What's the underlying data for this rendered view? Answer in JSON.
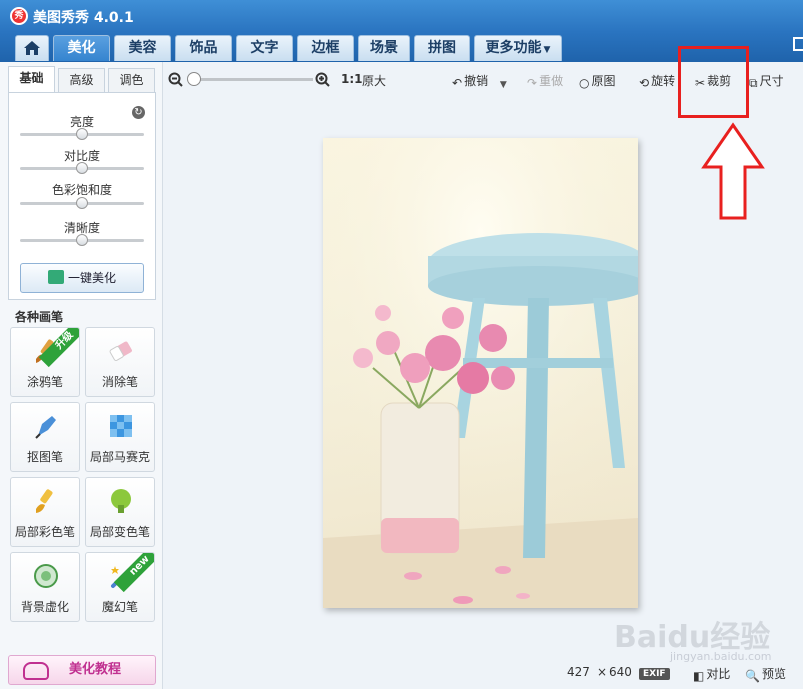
{
  "app": {
    "title": "美图秀秀 4.0.1",
    "logo_text": "秀"
  },
  "main_tabs": [
    {
      "label": "美化"
    },
    {
      "label": "美容"
    },
    {
      "label": "饰品"
    },
    {
      "label": "文字"
    },
    {
      "label": "边框"
    },
    {
      "label": "场景"
    },
    {
      "label": "拼图"
    },
    {
      "label": "更多功能"
    }
  ],
  "sub_tabs": [
    {
      "label": "基础"
    },
    {
      "label": "高级"
    },
    {
      "label": "调色"
    }
  ],
  "sliders": [
    {
      "label": "亮度",
      "level": 0.5
    },
    {
      "label": "对比度",
      "level": 0.5
    },
    {
      "label": "色彩饱和度",
      "level": 0.5
    },
    {
      "label": "清晰度",
      "level": 0.5
    }
  ],
  "one_key_label": "一键美化",
  "brush_section_title": "各种画笔",
  "tools": [
    {
      "label": "涂鸦笔",
      "ribbon": "升级",
      "icon": "brush-icon"
    },
    {
      "label": "消除笔",
      "icon": "eraser-icon"
    },
    {
      "label": "抠图笔",
      "icon": "pen-cutout-icon"
    },
    {
      "label": "局部马赛克",
      "icon": "mosaic-icon"
    },
    {
      "label": "局部彩色笔",
      "icon": "color-brush-icon"
    },
    {
      "label": "局部变色笔",
      "icon": "color-change-icon"
    },
    {
      "label": "背景虚化",
      "icon": "blur-icon"
    },
    {
      "label": "魔幻笔",
      "ribbon": "new",
      "icon": "magic-wand-icon"
    }
  ],
  "tutorial_label": "美化教程",
  "toolbar": {
    "zoom_ratio": "1:1",
    "original_size": "原大",
    "undo": "撤销",
    "redo": "重做",
    "original": "原图",
    "rotate": "旋转",
    "crop": "裁剪",
    "size": "尺寸"
  },
  "status": {
    "width": "427",
    "times": "×",
    "height": "640",
    "exif": "EXIF",
    "compare": "对比",
    "preview": "预览"
  },
  "watermark": {
    "brand": "Baidu经验",
    "url": "jingyan.baidu.com"
  },
  "colors": {
    "titlebar": "#2a74c0",
    "active_tab": "#3584cf",
    "annotation": "#e8201f",
    "ribbon": "#2ea23a"
  }
}
